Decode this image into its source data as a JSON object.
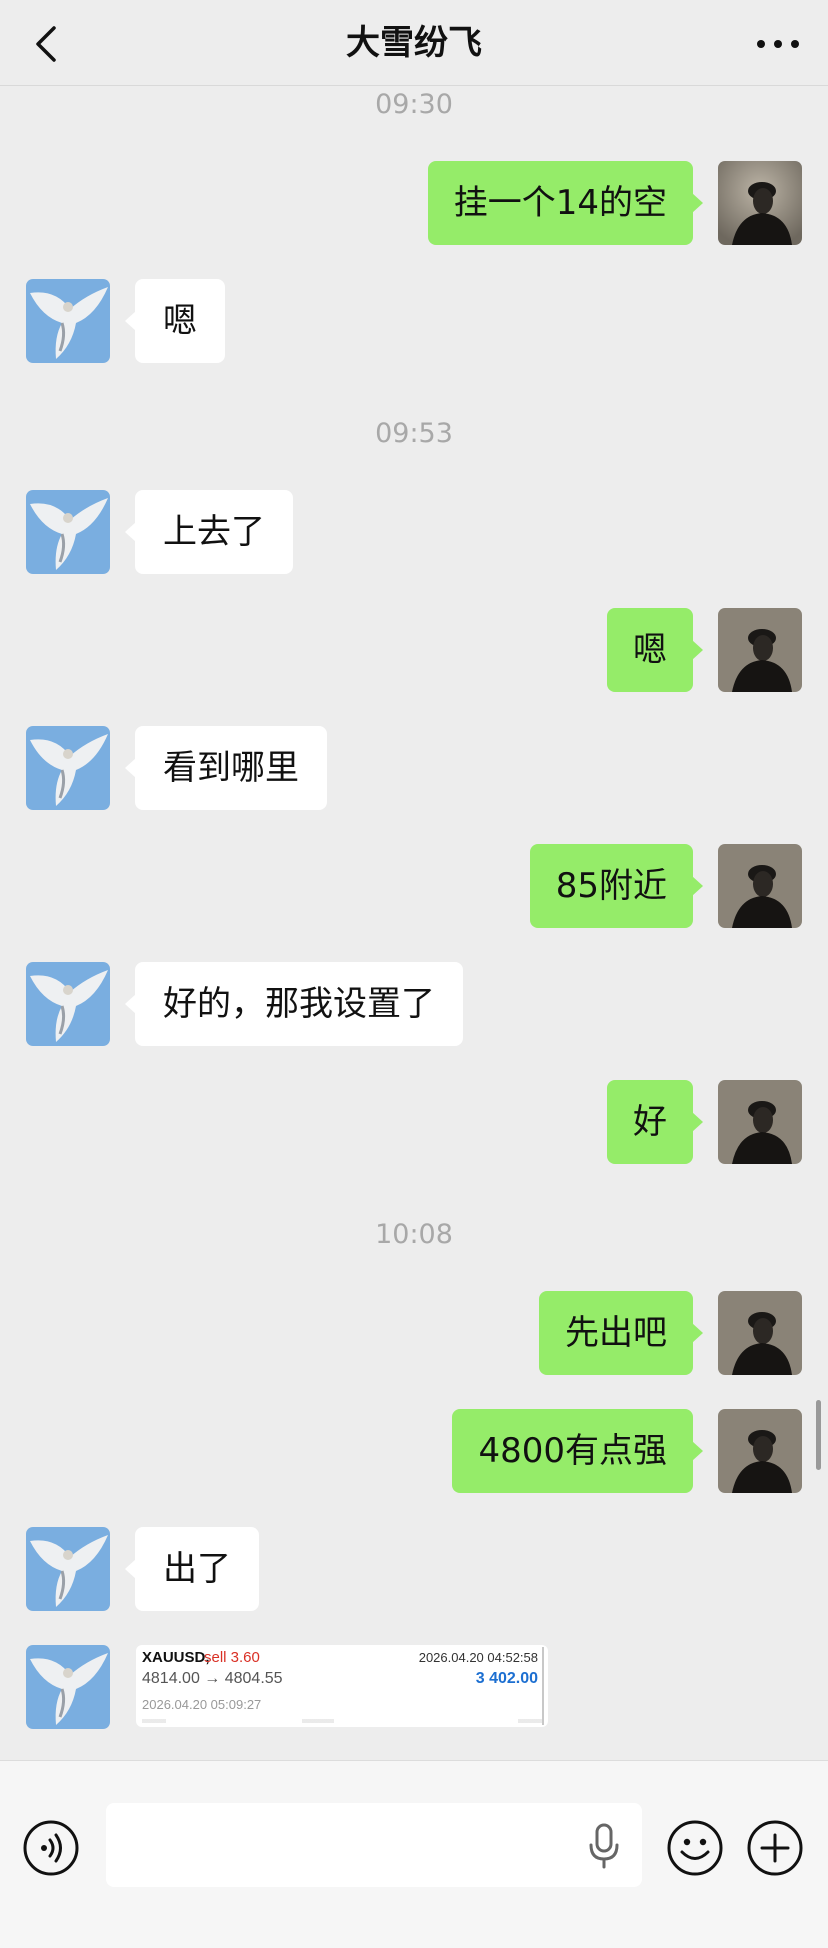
{
  "header": {
    "title": "大雪纷飞"
  },
  "messages": {
    "ts1": "09:30",
    "m1": "挂一个14的空",
    "m2": "嗯",
    "ts2": "09:53",
    "m3": "上去了",
    "m4": "嗯",
    "m5": "看到哪里",
    "m6": "85附近",
    "m7": "好的，那我设置了",
    "m8": "好",
    "ts3": "10:08",
    "m9": "先出吧",
    "m10": "4800有点强",
    "m11": "出了"
  },
  "trade_card": {
    "symbol": "XAUUSD,",
    "side": "sell 3.60",
    "open_time": "2026.04.20 04:52:58",
    "price": "4814.00 → 4804.55",
    "profit": "3 402.00",
    "close_time": "2026.04.20 05:09:27"
  },
  "input": {
    "placeholder": ""
  },
  "colors": {
    "background": "#ededed",
    "outgoing_bubble": "#95ec69",
    "incoming_bubble": "#ffffff",
    "sell_red": "#d93025",
    "profit_blue": "#1c6fd1"
  },
  "icons": {
    "back": "chevron-left-icon",
    "more": "more-dots-icon",
    "voice": "voice-icon",
    "mic": "microphone-icon",
    "emoji": "emoji-icon",
    "plus": "plus-icon"
  }
}
